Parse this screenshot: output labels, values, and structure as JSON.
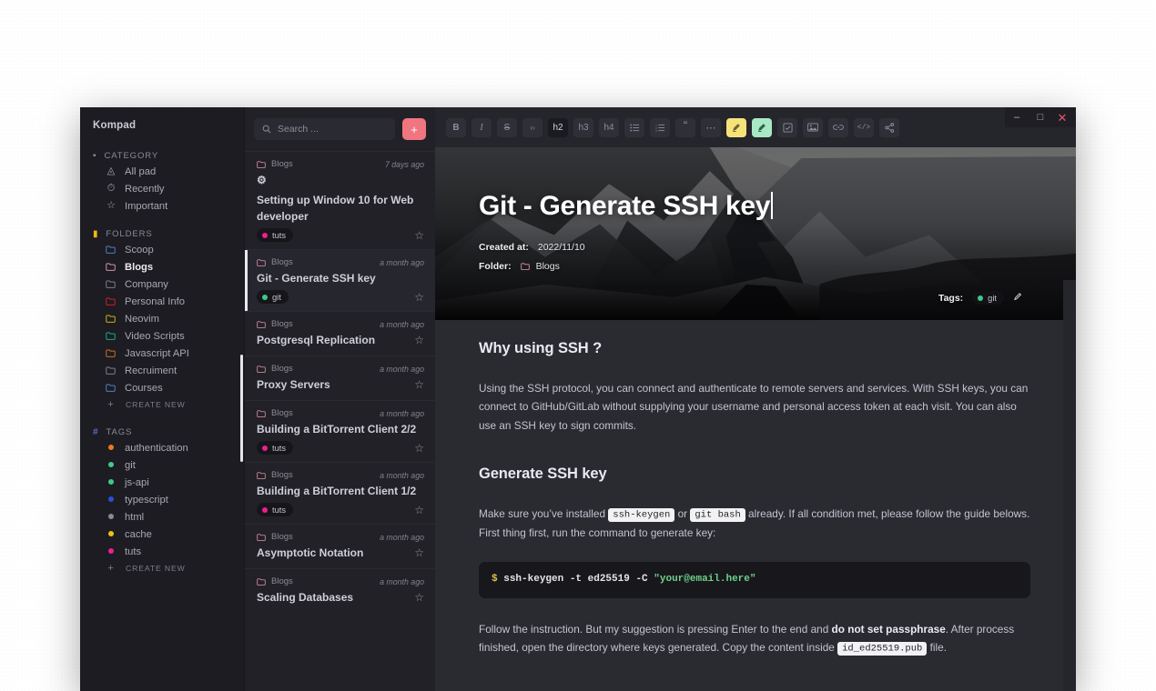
{
  "window": {
    "controls": [
      {
        "name": "minimize",
        "glyph": "–"
      },
      {
        "name": "maximize",
        "glyph": "□"
      },
      {
        "name": "close",
        "glyph": "✕"
      }
    ]
  },
  "sidebar": {
    "brand": "Kompad",
    "sections": [
      {
        "label": "CATEGORY",
        "icon": "bookmark-icon",
        "icon_color": "#c6c6d0",
        "items": [
          {
            "label": "All pad",
            "icon": "package-icon",
            "icon_color": "#a8a8b4"
          },
          {
            "label": "Recently",
            "icon": "clock-icon",
            "icon_color": "#a8a8b4"
          },
          {
            "label": "Important",
            "icon": "star-icon",
            "icon_color": "#a8a8b4"
          }
        ]
      },
      {
        "label": "FOLDERS",
        "icon": "folder-filled-icon",
        "icon_color": "#edb914",
        "items": [
          {
            "label": "Scoop",
            "icon": "folder-icon",
            "icon_color": "#5b8ed6",
            "active": false
          },
          {
            "label": "Blogs",
            "icon": "folder-icon",
            "icon_color": "#f0a6b4",
            "active": true
          },
          {
            "label": "Company",
            "icon": "folder-icon",
            "icon_color": "#8c8c98",
            "active": false
          },
          {
            "label": "Personal Info",
            "icon": "folder-icon",
            "icon_color": "#f01b2d",
            "active": false
          },
          {
            "label": "Neovim",
            "icon": "folder-icon",
            "icon_color": "#edc213",
            "active": false
          },
          {
            "label": "Video Scripts",
            "icon": "folder-icon",
            "icon_color": "#17c08a",
            "active": false
          },
          {
            "label": "Javascript API",
            "icon": "folder-icon",
            "icon_color": "#e87a22",
            "active": false
          },
          {
            "label": "Recruiment",
            "icon": "folder-icon",
            "icon_color": "#8c8c98",
            "active": false
          },
          {
            "label": "Courses",
            "icon": "folder-icon",
            "icon_color": "#5b8ed6",
            "active": false
          }
        ],
        "create_label": "CREATE NEW"
      },
      {
        "label": "TAGS",
        "icon": "hash-icon",
        "icon_color": "#5b6ed6",
        "items": [
          {
            "label": "authentication",
            "icon": "dot-icon",
            "icon_color": "#e87a22"
          },
          {
            "label": "git",
            "icon": "dot-icon",
            "icon_color": "#3fc98a"
          },
          {
            "label": "js-api",
            "icon": "dot-icon",
            "icon_color": "#3fc98a"
          },
          {
            "label": "typescript",
            "icon": "dot-icon",
            "icon_color": "#2b4edb"
          },
          {
            "label": "html",
            "icon": "dot-icon",
            "icon_color": "#8a8a96"
          },
          {
            "label": "cache",
            "icon": "dot-icon",
            "icon_color": "#edc213"
          },
          {
            "label": "tuts",
            "icon": "dot-icon",
            "icon_color": "#ee1f8e"
          }
        ],
        "create_label": "CREATE NEW"
      }
    ]
  },
  "notelist": {
    "search_placeholder": "Search ...",
    "search_value": "",
    "add_label": "+",
    "notes": [
      {
        "folder": "Blogs",
        "time": "7 days ago",
        "emoji": "⚙",
        "title": "Setting up Window 10 for Web developer",
        "tag": "tuts",
        "tag_color": "#ee1f8e",
        "selected": false,
        "starred": false
      },
      {
        "folder": "Blogs",
        "time": "a month ago",
        "emoji": "",
        "title": "Git - Generate SSH key",
        "tag": "git",
        "tag_color": "#3fc98a",
        "selected": true,
        "starred": false
      },
      {
        "folder": "Blogs",
        "time": "a month ago",
        "emoji": "",
        "title": "Postgresql Replication",
        "tag": "",
        "tag_color": "",
        "selected": false,
        "starred": false
      },
      {
        "folder": "Blogs",
        "time": "a month ago",
        "emoji": "",
        "title": "Proxy Servers",
        "tag": "",
        "tag_color": "",
        "selected": false,
        "starred": false
      },
      {
        "folder": "Blogs",
        "time": "a month ago",
        "emoji": "",
        "title": "Building a BitTorrent Client 2/2",
        "tag": "tuts",
        "tag_color": "#ee1f8e",
        "selected": false,
        "starred": false
      },
      {
        "folder": "Blogs",
        "time": "a month ago",
        "emoji": "",
        "title": "Building a BitTorrent Client 1/2",
        "tag": "tuts",
        "tag_color": "#ee1f8e",
        "selected": false,
        "starred": false
      },
      {
        "folder": "Blogs",
        "time": "a month ago",
        "emoji": "",
        "title": "Asymptotic Notation",
        "tag": "",
        "tag_color": "",
        "selected": false,
        "starred": false
      },
      {
        "folder": "Blogs",
        "time": "a month ago",
        "emoji": "",
        "title": "Scaling Databases",
        "tag": "",
        "tag_color": "",
        "selected": false,
        "starred": false
      }
    ]
  },
  "toolbar": {
    "buttons": [
      {
        "name": "bold-button",
        "label": "B",
        "style": "b",
        "active": false
      },
      {
        "name": "italic-button",
        "label": "I",
        "style": "i",
        "active": false
      },
      {
        "name": "strikethrough-button",
        "label": "S",
        "style": "s",
        "active": false
      },
      {
        "name": "inline-code-button",
        "label": "‹›",
        "style": "code",
        "active": false
      },
      {
        "name": "heading-2-button",
        "label": "h2",
        "style": "h",
        "active": true
      },
      {
        "name": "heading-3-button",
        "label": "h3",
        "style": "h",
        "active": false
      },
      {
        "name": "heading-4-button",
        "label": "h4",
        "style": "h",
        "active": false
      },
      {
        "name": "bullet-list-button",
        "label": "☰",
        "style": "icon",
        "active": false
      },
      {
        "name": "ordered-list-button",
        "label": "☷",
        "style": "icon",
        "active": false
      },
      {
        "name": "blockquote-button",
        "label": "“",
        "style": "quote",
        "active": false
      },
      {
        "name": "horizontal-rule-button",
        "label": "⋯",
        "style": "icon",
        "active": false
      },
      {
        "name": "highlight-yellow-button",
        "label": "✎",
        "style": "hl-yellow",
        "active": false
      },
      {
        "name": "highlight-green-button",
        "label": "✎",
        "style": "hl-green",
        "active": false
      },
      {
        "name": "checkbox-button",
        "label": "☑",
        "style": "icon",
        "active": false
      },
      {
        "name": "image-button",
        "label": "⛰",
        "style": "icon",
        "active": false
      },
      {
        "name": "link-button",
        "label": "⚓",
        "style": "icon",
        "active": false
      },
      {
        "name": "code-block-button",
        "label": "</>",
        "style": "icon",
        "active": false
      },
      {
        "name": "share-button",
        "label": "⮀",
        "style": "icon",
        "active": false
      }
    ]
  },
  "note": {
    "title": "Git - Generate SSH key",
    "created_label": "Created at:",
    "created_value": "2022/11/10",
    "folder_label": "Folder:",
    "folder_value": "Blogs",
    "tags_label": "Tags:",
    "tag": "git",
    "tag_color": "#3fc98a"
  },
  "content": {
    "heading_1": "Why using SSH ?",
    "paragraph_1": "Using the SSH protocol, you can connect and authenticate to remote servers and services. With SSH keys, you can connect to GitHub/GitLab without supplying your username and personal access token at each visit. You can also use an SSH key to sign commits.",
    "heading_2": "Generate SSH key",
    "p2_a": "Make sure you’ve installed ",
    "p2_code1": "ssh-keygen",
    "p2_b": " or ",
    "p2_code2": "git bash",
    "p2_c": " already. If all condition met, please follow the guide belows. First thing first, run the command to generate key:",
    "code_prompt": "$",
    "code_command": "ssh-keygen -t ed25519 -C",
    "code_string": "\"your@email.here\"",
    "p3_a": "Follow the instruction. But my suggestion is pressing Enter to the end and ",
    "p3_bold": "do not set passphrase",
    "p3_b": ". After process finished, open the directory where keys generated. Copy the content inside ",
    "p3_code": "id_ed25519.pub",
    "p3_c": " file."
  }
}
